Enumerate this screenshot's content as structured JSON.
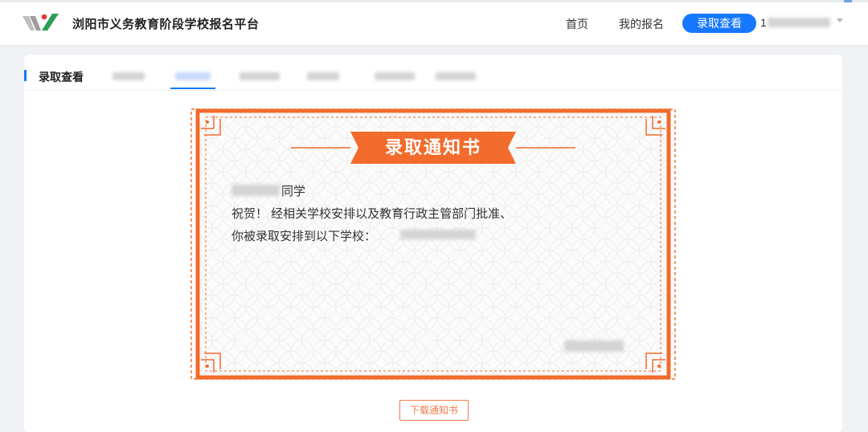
{
  "header": {
    "site_title": "浏阳市义务教育阶段学校报名平台",
    "nav": {
      "home": "首页",
      "my_registration": "我的报名",
      "admission_query": "录取查看"
    },
    "user": {
      "phone_prefix": "1"
    },
    "accent_color": "#1677ff"
  },
  "main": {
    "section_title": "录取查看"
  },
  "certificate": {
    "title": "录取通知书",
    "student_suffix": "同学",
    "congrats_line": "祝贺！ 经相关学校安排以及教育行政主管部门批准、",
    "assign_line": "你被录取安排到以下学校：",
    "accent_color": "#f26b2c"
  },
  "actions": {
    "download_label": "下载通知书"
  }
}
